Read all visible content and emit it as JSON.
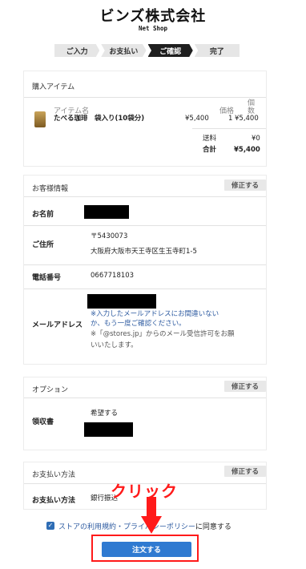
{
  "header": {
    "brand": "ビンズ株式会社",
    "subtitle": "Net Shop"
  },
  "steps": [
    {
      "label": "ご入力",
      "active": false
    },
    {
      "label": "お支払い",
      "active": false
    },
    {
      "label": "ご確認",
      "active": true
    },
    {
      "label": "完了",
      "active": false
    }
  ],
  "purchase": {
    "title": "購入アイテム",
    "col_item": "アイテム名",
    "col_price": "価格",
    "col_qty_1": "個",
    "col_qty_2": "数",
    "item_name": "たべる珈琲　袋入り(10袋分)",
    "item_price": "¥5,400",
    "item_qty": "1",
    "item_total": "¥5,400",
    "shipping_label": "送料",
    "shipping_value": "¥0",
    "total_label": "合計",
    "total_value": "¥5,400"
  },
  "customer": {
    "title": "お客様情報",
    "edit_label": "修正する",
    "name_label": "お名前",
    "address_label": "ご住所",
    "postal": "〒5430073",
    "address": "大阪府大阪市天王寺区生玉寺町1-5",
    "phone_label": "電話番号",
    "phone": "0667718103",
    "email_label": "メールアドレス",
    "email_note_1": "※入力したメールアドレスにお間違いない",
    "email_note_2": "か、もう一度ご確認ください。",
    "email_note_3": "※「@stores.jp」からのメール受信許可をお願",
    "email_note_4": "いいたします。"
  },
  "option": {
    "title": "オプション",
    "edit_label": "修正する",
    "receipt_label": "領収書",
    "receipt_value": "希望する"
  },
  "payment": {
    "title": "お支払い方法",
    "edit_label": "修正する",
    "method_label": "お支払い方法",
    "method_value": "銀行振込"
  },
  "agreement": {
    "checked": true,
    "link_text": "ストアの利用規約・プライバシーポリシー",
    "rest_text": "に同意する"
  },
  "order_button": "注文する",
  "annotation": {
    "text": "クリック",
    "color": "#ff1a1a"
  },
  "colors": {
    "accent": "#2f7ad1",
    "link": "#2c5aa0",
    "annotation": "#ff1a1a"
  }
}
